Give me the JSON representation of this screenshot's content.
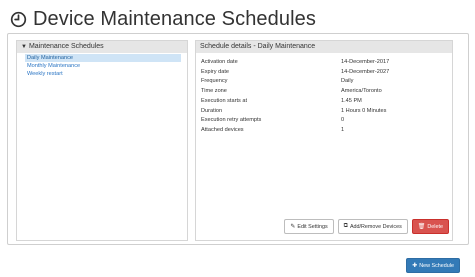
{
  "header": {
    "title": "Device Maintenance Schedules"
  },
  "left_panel": {
    "title": "Maintenance Schedules",
    "items": [
      {
        "label": "Daily Maintenance",
        "selected": true
      },
      {
        "label": "Monthly Maintenance",
        "selected": false
      },
      {
        "label": "Weekly restart",
        "selected": false
      }
    ]
  },
  "details": {
    "title": "Schedule details - Daily Maintenance",
    "rows": [
      {
        "key": "Activation date",
        "value": "14-December-2017"
      },
      {
        "key": "Expiry date",
        "value": "14-December-2027"
      },
      {
        "key": "Frequency",
        "value": "Daily"
      },
      {
        "key": "Time zone",
        "value": "America/Toronto"
      },
      {
        "key": "Execution starts at",
        "value": "1.45 PM"
      },
      {
        "key": "Duration",
        "value": "1 Hours 0 Minutes"
      },
      {
        "key": "Execution retry attempts",
        "value": "0"
      },
      {
        "key": "Attached devices",
        "value": "1"
      }
    ]
  },
  "actions": {
    "edit_settings": "Edit Settings",
    "add_remove_devices": "Add/Remove Devices",
    "delete": "Delete"
  },
  "footer": {
    "new_schedule": "New Schedule"
  },
  "colors": {
    "accent": "#337ab7",
    "danger": "#d9534f",
    "link": "#2a75c4",
    "selected_bg": "#cfe4f6"
  },
  "icons": {
    "title": "clock-icon",
    "panel": "caret-down-icon",
    "edit": "edit-icon",
    "devices": "devices-icon",
    "delete": "trash-icon",
    "new": "plus-icon"
  }
}
